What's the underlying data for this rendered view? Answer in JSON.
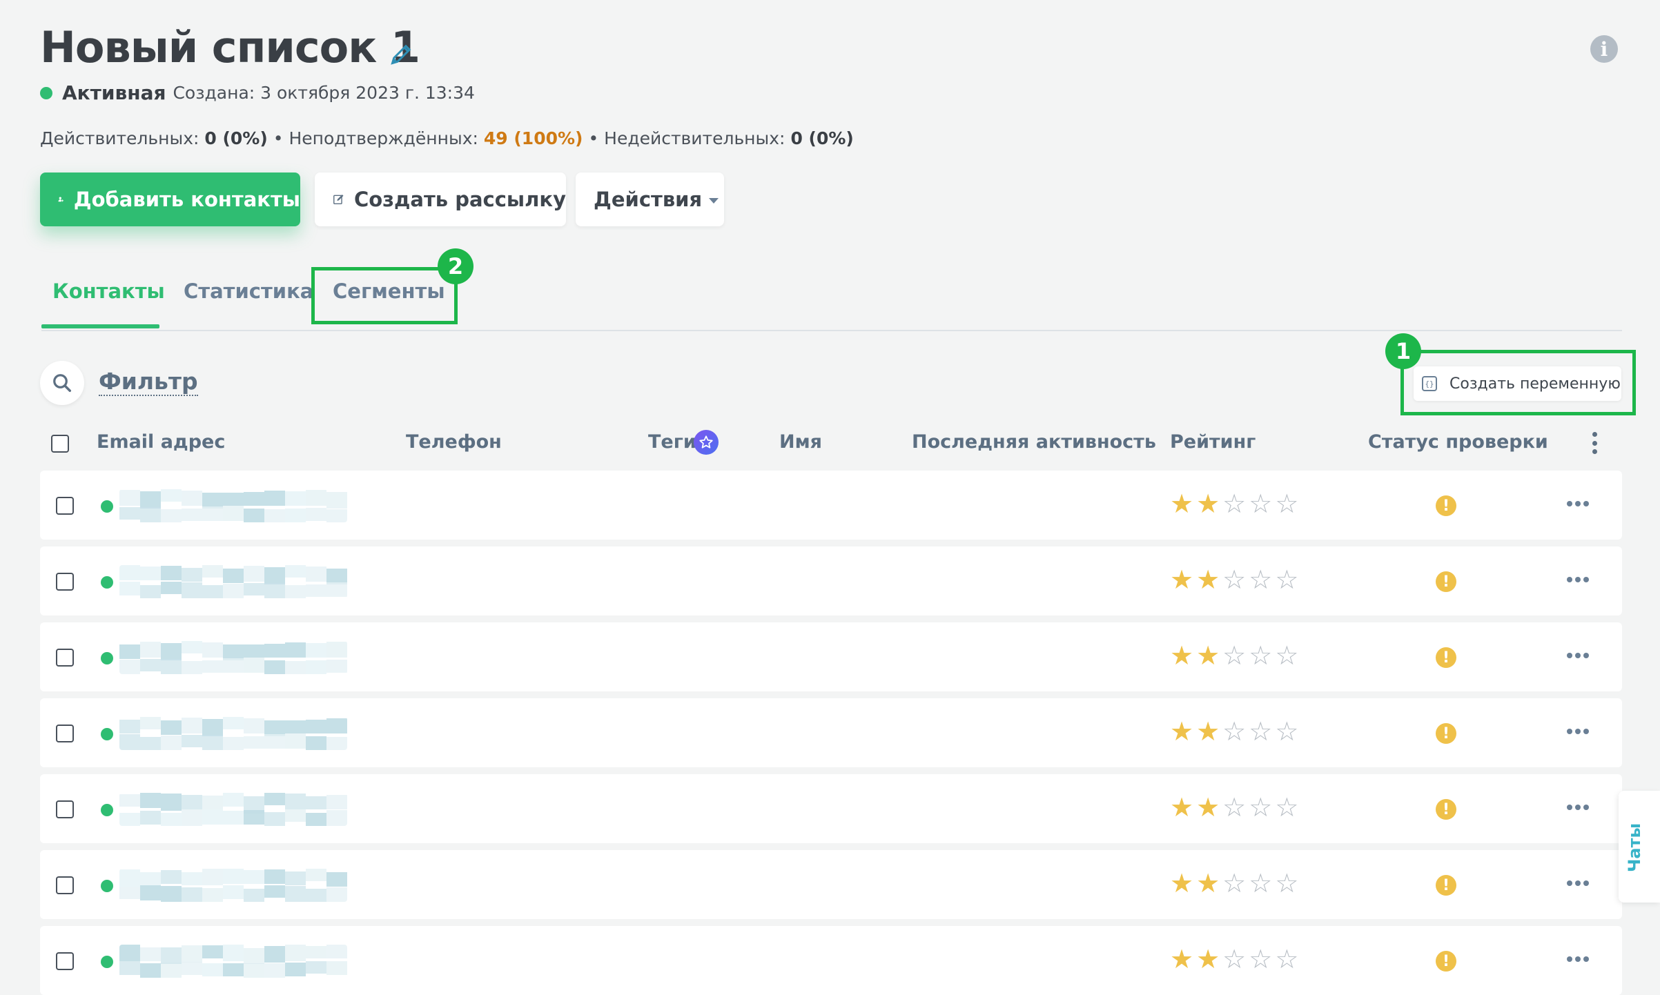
{
  "header": {
    "title": "Новый список 1",
    "status": "Активная",
    "created": "Создана: 3 октября 2023 г. 13:34"
  },
  "stats": {
    "valid_label": "Действительных:",
    "valid_value": "0 (0%)",
    "sep1": "•",
    "unconfirmed_label": "Неподтверждённых:",
    "unconfirmed_value": "49 (100%)",
    "sep2": "•",
    "invalid_label": "Недействительных:",
    "invalid_value": "0 (0%)"
  },
  "buttons": {
    "add_contacts": "Добавить контакты",
    "create_mailing": "Создать рассылку",
    "actions": "Действия"
  },
  "tabs": [
    {
      "label": "Контакты",
      "active": true
    },
    {
      "label": "Статистика",
      "active": false
    },
    {
      "label": "Сегменты",
      "active": false
    }
  ],
  "annotations": {
    "badge_1": "1",
    "badge_2": "2"
  },
  "filter": {
    "label": "Фильтр"
  },
  "create_variable": {
    "label": "Создать переменную"
  },
  "table": {
    "columns": [
      "Email адрес",
      "Телефон",
      "Теги",
      "Имя",
      "Последняя активность",
      "Рейтинг",
      "Статус проверки"
    ],
    "rows": [
      {
        "rating": 2,
        "status": "warning"
      },
      {
        "rating": 2,
        "status": "warning"
      },
      {
        "rating": 2,
        "status": "warning"
      },
      {
        "rating": 2,
        "status": "warning"
      },
      {
        "rating": 2,
        "status": "warning"
      },
      {
        "rating": 2,
        "status": "warning"
      },
      {
        "rating": 2,
        "status": "warning"
      }
    ]
  },
  "chats": {
    "label": "Чаты"
  },
  "colors": {
    "accent_green": "#2fbd72",
    "highlight_green": "#1db64a",
    "warning_orange": "#cf7a14",
    "star_yellow": "#efc14a",
    "chats_teal": "#37b3c8"
  }
}
